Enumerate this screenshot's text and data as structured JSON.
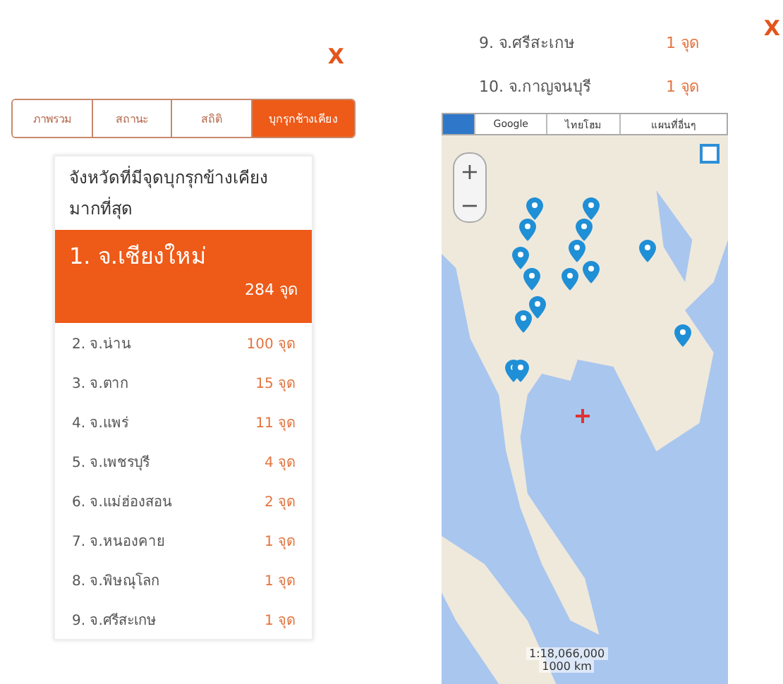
{
  "left_screen": {
    "close": "X",
    "tabs": [
      {
        "label": "ภาพรวม",
        "selected": false
      },
      {
        "label": "สถานะ",
        "selected": false
      },
      {
        "label": "สถิติ",
        "selected": false
      },
      {
        "label": "บุกรุกช้างเคียง",
        "selected": true
      }
    ],
    "ranking": {
      "title": "จังหวัดที่มีจุดบุกรุกข้างเคียงมากที่สุด",
      "top": {
        "name": "1. จ.เชียงใหม่",
        "count": "284 จุด"
      },
      "rows": [
        {
          "name": "2. จ.น่าน",
          "count": "100 จุด"
        },
        {
          "name": "3. จ.ตาก",
          "count": "15 จุด"
        },
        {
          "name": "4. จ.แพร่",
          "count": "11 จุด"
        },
        {
          "name": "5. จ.เพชรบุรี",
          "count": "4 จุด"
        },
        {
          "name": "6. จ.แม่ฮ่องสอน",
          "count": "2 จุด"
        },
        {
          "name": "7. จ.หนองคาย",
          "count": "1 จุด"
        },
        {
          "name": "8. จ.พิษณุโลก",
          "count": "1 จุด"
        },
        {
          "name": "9. จ.ศรีสะเกษ",
          "count": "1 จุด"
        }
      ]
    }
  },
  "right_screen": {
    "close": "X",
    "rows": [
      {
        "name": "9. จ.ศรีสะเกษ",
        "count": "1 จุด"
      },
      {
        "name": "10. จ.กาญจนบุรี",
        "count": "1 จุด"
      }
    ],
    "map": {
      "layers": [
        {
          "label": "Google",
          "selected": false
        },
        {
          "label": "ไทยโฮม",
          "selected": false
        },
        {
          "label": "แผนที่อื่นๆ",
          "selected": false
        }
      ],
      "zoom_in": "+",
      "zoom_out": "−",
      "scale": "1:18,066,000",
      "scale_distance": "1000 km"
    }
  }
}
